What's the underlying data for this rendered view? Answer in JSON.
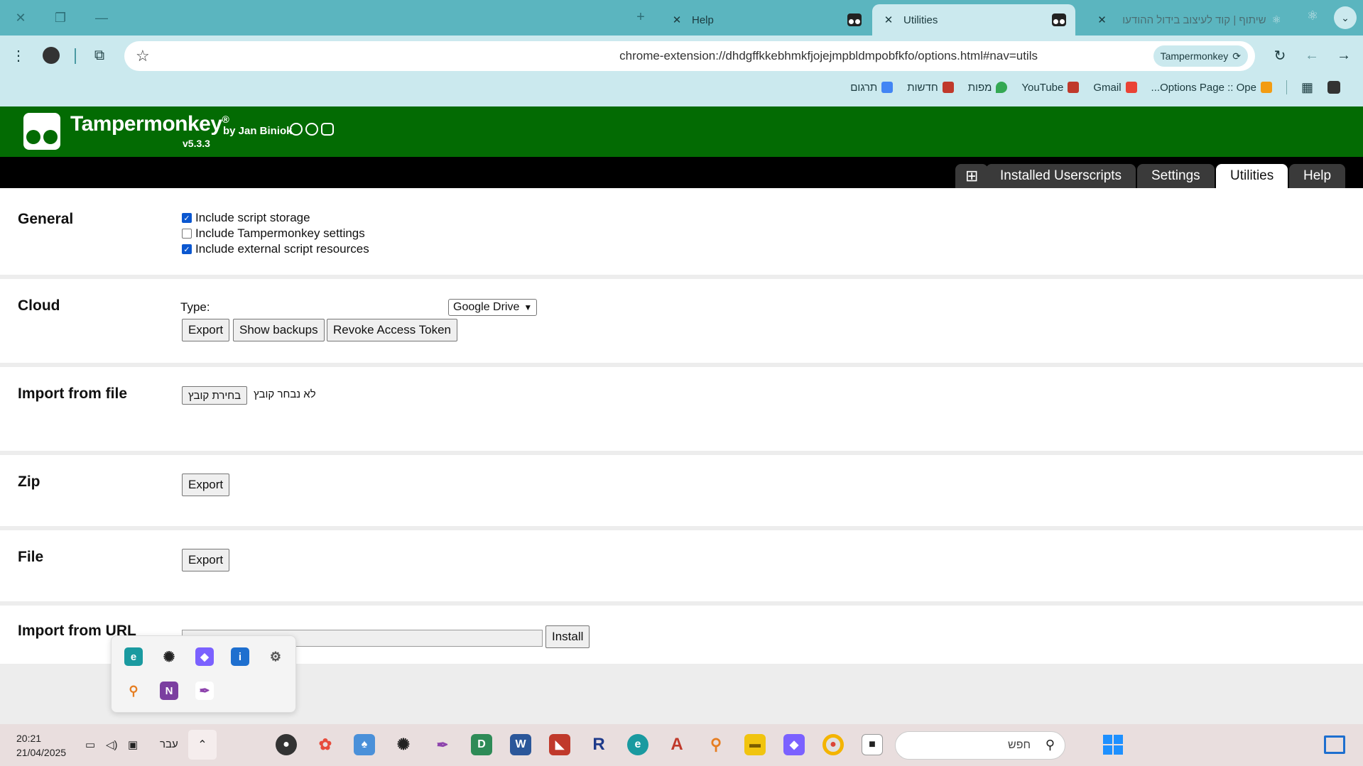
{
  "browser": {
    "tabs": [
      {
        "title": "Help"
      },
      {
        "title": "Utilities"
      },
      {
        "title": "שיתוף | קוד לעיצוב בידול ההודעו"
      }
    ],
    "url": "chrome-extension://dhdgffkkebhmkfjojejmpbldmpobfkfo/options.html#nav=utils",
    "extension_chip": "Tampermonkey",
    "bookmarks": [
      {
        "label": "תרגום",
        "color": "#4285f4"
      },
      {
        "label": "חדשות",
        "color": "#c0392b"
      },
      {
        "label": "מפות",
        "color": "#34a853"
      },
      {
        "label": "YouTube",
        "color": "#c0392b"
      },
      {
        "label": "Gmail",
        "color": "#ea4335"
      },
      {
        "label": "Options Page :: Ope...",
        "color": "#f39c12"
      }
    ]
  },
  "tm": {
    "title": "Tampermonkey",
    "reg": "®",
    "by": "by Jan Biniok",
    "version": "v5.3.3"
  },
  "nav": {
    "plus": "⊞",
    "tabs": [
      "Installed Userscripts",
      "Settings",
      "Utilities",
      "Help"
    ],
    "active": "Utilities"
  },
  "sections": {
    "general": {
      "title": "General",
      "options": [
        {
          "label": "Include script storage",
          "checked": true
        },
        {
          "label": "Include Tampermonkey settings",
          "checked": false
        },
        {
          "label": "Include external script resources",
          "checked": true
        }
      ]
    },
    "cloud": {
      "title": "Cloud",
      "type_label": "Type:",
      "type_value": "Google Drive",
      "buttons": [
        "Export",
        "Show backups",
        "Revoke Access Token"
      ]
    },
    "import_file": {
      "title": "Import from file",
      "choose_button": "בחירת קובץ",
      "no_file": "לא נבחר קובץ"
    },
    "zip": {
      "title": "Zip",
      "button": "Export"
    },
    "file": {
      "title": "File",
      "button": "Export"
    },
    "import_url": {
      "title": "Import from URL",
      "value": "",
      "button": "Install"
    }
  },
  "taskbar": {
    "time": "20:21",
    "date": "21/04/2025",
    "lang": "עבר",
    "search_placeholder": "חפש"
  }
}
